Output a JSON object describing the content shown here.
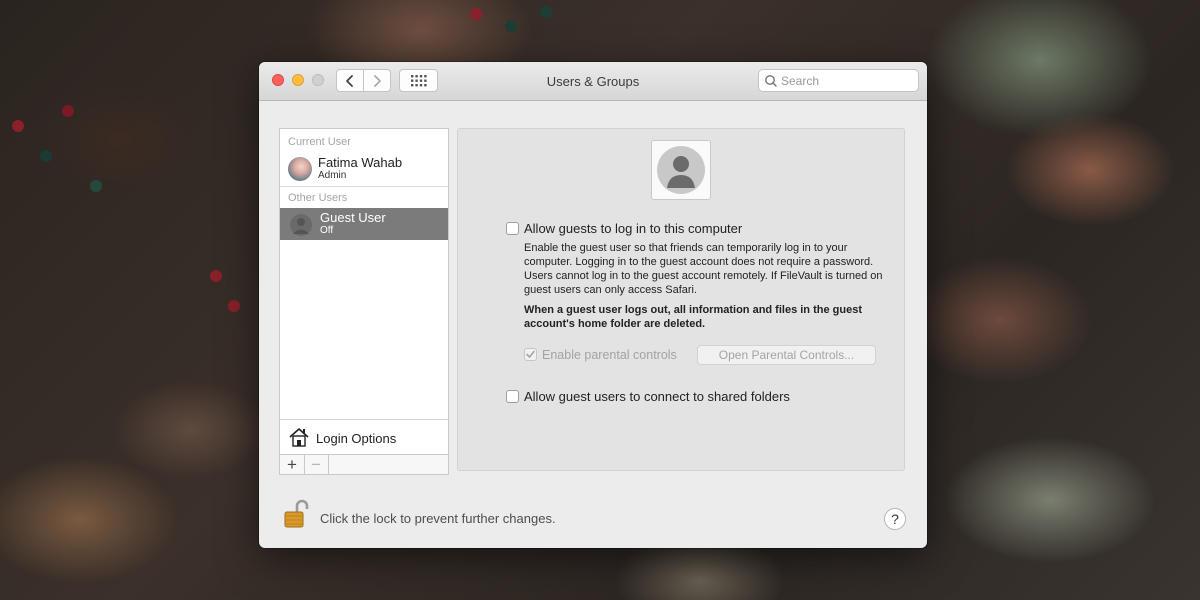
{
  "window": {
    "title": "Users & Groups"
  },
  "search": {
    "placeholder": "Search"
  },
  "sidebar": {
    "current_user_label": "Current User",
    "current_user": {
      "name": "Fatima Wahab",
      "role": "Admin"
    },
    "other_users_label": "Other Users",
    "other_users": [
      {
        "name": "Guest User",
        "status": "Off",
        "selected": true
      }
    ],
    "login_options_label": "Login Options",
    "add_label": "+",
    "remove_label": "−"
  },
  "panel": {
    "allow_guest_login": {
      "label": "Allow guests to log in to this computer",
      "checked": false
    },
    "description": "Enable the guest user so that friends can temporarily log in to your computer. Logging in to the guest account does not require a password. Users cannot log in to the guest account remotely. If FileVault is turned on guest users can only access Safari.",
    "warning": "When a guest user logs out, all information and files in the guest account's home folder are deleted.",
    "parental_controls": {
      "label": "Enable parental controls",
      "checked": true,
      "enabled": false
    },
    "open_parental_controls_label": "Open Parental Controls...",
    "allow_shared_folders": {
      "label": "Allow guest users to connect to shared folders",
      "checked": false
    }
  },
  "footer": {
    "lock_text": "Click the lock to prevent further changes.",
    "help_label": "?"
  },
  "colors": {
    "selected_row": "#7b7b7b",
    "close": "#fc605c",
    "minimize": "#fdbc40",
    "zoom_inactive": "#d0d0d0",
    "lock_gold": "#d99a2b"
  }
}
